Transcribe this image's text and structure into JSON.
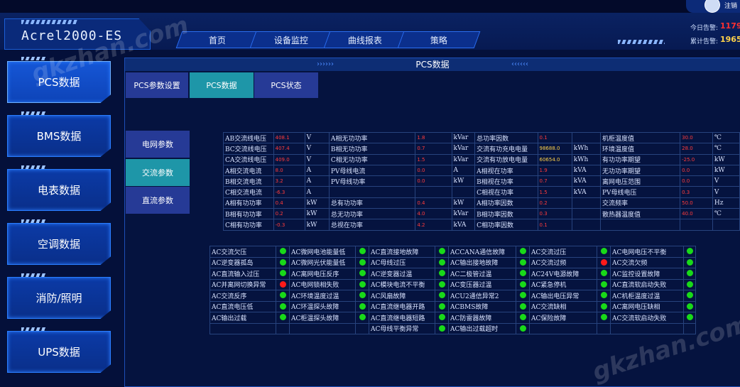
{
  "header": {
    "logout_label": "注销",
    "brand": "Acrel2000-ES",
    "nav": [
      "首页",
      "设备监控",
      "曲线报表",
      "策略"
    ],
    "alarm_today_label": "今日告警:",
    "alarm_today_value": "1179",
    "alarm_total_label": "累计告警:",
    "alarm_total_value": "1965"
  },
  "sidebar": [
    "PCS数据",
    "BMS数据",
    "电表数据",
    "空调数据",
    "消防/照明",
    "UPS数据"
  ],
  "panel": {
    "title": "PCS数据",
    "tabs": [
      "PCS参数设置",
      "PCS数据",
      "PCS状态"
    ],
    "subtabs": [
      "电网参数",
      "交流参数",
      "直流参数"
    ]
  },
  "params": [
    [
      [
        "AB交流线电压",
        "408.1",
        "V"
      ],
      [
        "A相无功功率",
        "1.8",
        "kVar"
      ],
      [
        "总功率因数",
        "0.1",
        ""
      ],
      [
        "机柜温度值",
        "30.0",
        "℃"
      ]
    ],
    [
      [
        "BC交流线电压",
        "407.4",
        "V"
      ],
      [
        "B相无功功率",
        "0.7",
        "kVar"
      ],
      [
        "交流有功充电电量",
        "98688.0",
        "kWh"
      ],
      [
        "环境温度值",
        "28.0",
        "℃"
      ]
    ],
    [
      [
        "CA交流线电压",
        "409.0",
        "V"
      ],
      [
        "C相无功功率",
        "1.5",
        "kVar"
      ],
      [
        "交流有功放电电量",
        "60654.0",
        "kWh"
      ],
      [
        "有功功率期望",
        "-25.0",
        "kW"
      ]
    ],
    [
      [
        "A相交流电流",
        "8.0",
        "A"
      ],
      [
        "PV母线电流",
        "0.0",
        "A"
      ],
      [
        "A相视在功率",
        "1.9",
        "kVA"
      ],
      [
        "无功功率期望",
        "0.0",
        "kW"
      ]
    ],
    [
      [
        "B相交流电流",
        "3.2",
        "A"
      ],
      [
        "PV母线功率",
        "0.0",
        "kW"
      ],
      [
        "B相视在功率",
        "0.7",
        "kVA"
      ],
      [
        "离网电压范围",
        "0.0",
        "V"
      ]
    ],
    [
      [
        "C相交流电流",
        "-6.3",
        "A"
      ],
      [
        "",
        "",
        ""
      ],
      [
        "C相视在功率",
        "1.5",
        "kVA"
      ],
      [
        "PV母线电压",
        "0.3",
        "V"
      ]
    ],
    [
      [
        "A相有功功率",
        "0.4",
        "kW"
      ],
      [
        "总有功功率",
        "0.4",
        "kW"
      ],
      [
        "A相功率因数",
        "0.2",
        ""
      ],
      [
        "交流频率",
        "50.0",
        "Hz"
      ]
    ],
    [
      [
        "B相有功功率",
        "0.2",
        "kW"
      ],
      [
        "总无功功率",
        "4.0",
        "kVar"
      ],
      [
        "B相功率因数",
        "0.3",
        ""
      ],
      [
        "散热器温度值",
        "40.0",
        "℃"
      ]
    ],
    [
      [
        "C相有功功率",
        "-0.3",
        "kW"
      ],
      [
        "总视在功率",
        "4.2",
        "kVA"
      ],
      [
        "C相功率因数",
        "0.1",
        ""
      ],
      [
        "",
        "",
        ""
      ]
    ]
  ],
  "status": [
    [
      [
        "AC交流欠压",
        "g"
      ],
      [
        "AC微网电池能量低",
        "g"
      ],
      [
        "AC直流接地故障",
        "g"
      ],
      [
        "ACCANA通信故障",
        "g"
      ],
      [
        "AC交流过压",
        "g"
      ],
      [
        "AC电网电压不平衡",
        "g"
      ]
    ],
    [
      [
        "AC逆变器孤岛",
        "g"
      ],
      [
        "AC微网光伏能量低",
        "g"
      ],
      [
        "AC母线过压",
        "g"
      ],
      [
        "AC输出接地故障",
        "g"
      ],
      [
        "AC交流过频",
        "r"
      ],
      [
        "AC交流欠频",
        "g"
      ]
    ],
    [
      [
        "AC直流输入过压",
        "g"
      ],
      [
        "AC离网电压反序",
        "g"
      ],
      [
        "AC逆变器过温",
        "g"
      ],
      [
        "AC二极管过温",
        "g"
      ],
      [
        "AC24V电源故障",
        "g"
      ],
      [
        "AC监控设置故障",
        "g"
      ]
    ],
    [
      [
        "AC并离网切换异常",
        "r"
      ],
      [
        "AC电网锁相失败",
        "g"
      ],
      [
        "AC模块电流不平衡",
        "g"
      ],
      [
        "AC变压器过温",
        "g"
      ],
      [
        "AC紧急停机",
        "g"
      ],
      [
        "AC直流软启动失败",
        "g"
      ]
    ],
    [
      [
        "AC交流反序",
        "g"
      ],
      [
        "AC环境温度过温",
        "g"
      ],
      [
        "AC风扇故障",
        "g"
      ],
      [
        "ACU2通信异常2",
        "g"
      ],
      [
        "AC输出电压异常",
        "g"
      ],
      [
        "AC机柜温度过温",
        "g"
      ]
    ],
    [
      [
        "AC直流电压低",
        "g"
      ],
      [
        "AC环温探头故障",
        "g"
      ],
      [
        "AC直流继电器开路",
        "g"
      ],
      [
        "ACBMS故障",
        "g"
      ],
      [
        "AC交流缺相",
        "g"
      ],
      [
        "AC离网电压缺相",
        "g"
      ]
    ],
    [
      [
        "AC输出过载",
        "g"
      ],
      [
        "AC柜温探头故障",
        "g"
      ],
      [
        "AC直流继电器短路",
        "g"
      ],
      [
        "AC防雷器故障",
        "g"
      ],
      [
        "AC保险故障",
        "g"
      ],
      [
        "AC交流软启动失败",
        "g"
      ]
    ],
    [
      [
        "",
        ""
      ],
      [
        "",
        ""
      ],
      [
        "AC母线平衡异常",
        "g"
      ],
      [
        "AC输出过载超时",
        "g"
      ],
      [
        "",
        ""
      ],
      [
        "",
        ""
      ]
    ]
  ],
  "colors": {
    "green": "#19d919",
    "red": "#ff1a1a",
    "alarm": "#ff3030"
  },
  "watermark": "gkzhan.com"
}
